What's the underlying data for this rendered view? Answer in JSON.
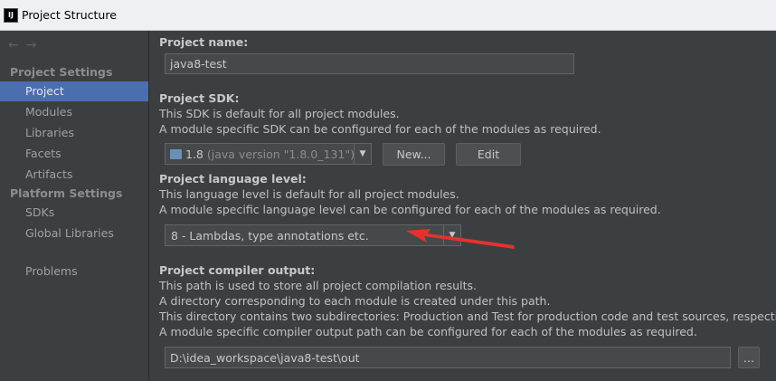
{
  "window": {
    "title": "Project Structure",
    "app_icon": "IJ"
  },
  "sidebar": {
    "back_icon": "←",
    "forward_icon": "→",
    "project_settings_header": "Project Settings",
    "project_items": [
      "Project",
      "Modules",
      "Libraries",
      "Facets",
      "Artifacts"
    ],
    "platform_settings_header": "Platform Settings",
    "platform_items": [
      "SDKs",
      "Global Libraries"
    ],
    "problems": "Problems",
    "selected": "Project"
  },
  "project_name": {
    "label": "Project name:",
    "value": "java8-test"
  },
  "sdk": {
    "label": "Project SDK:",
    "desc1": "This SDK is default for all project modules.",
    "desc2": "A module specific SDK can be configured for each of the modules as required.",
    "selected_name": "1.8",
    "selected_version": "(java version \"1.8.0_131\")",
    "new_button": "New...",
    "edit_button": "Edit"
  },
  "language_level": {
    "label": "Project language level:",
    "desc1": "This language level is default for all project modules.",
    "desc2": "A module specific language level can be configured for each of the modules as required.",
    "selected": "8 - Lambdas, type annotations etc."
  },
  "compiler_output": {
    "label": "Project compiler output:",
    "desc1": "This path is used to store all project compilation results.",
    "desc2": "A directory corresponding to each module is created under this path.",
    "desc3": "This directory contains two subdirectories: Production and Test for production code and test sources, respectively.",
    "desc4": "A module specific compiler output path can be configured for each of the modules as required.",
    "path": "D:\\idea_workspace\\java8-test\\out",
    "browse_button": "..."
  },
  "colors": {
    "selection": "#4b6eaf",
    "annotation_arrow": "#e8312f",
    "background": "#3c3f41"
  }
}
